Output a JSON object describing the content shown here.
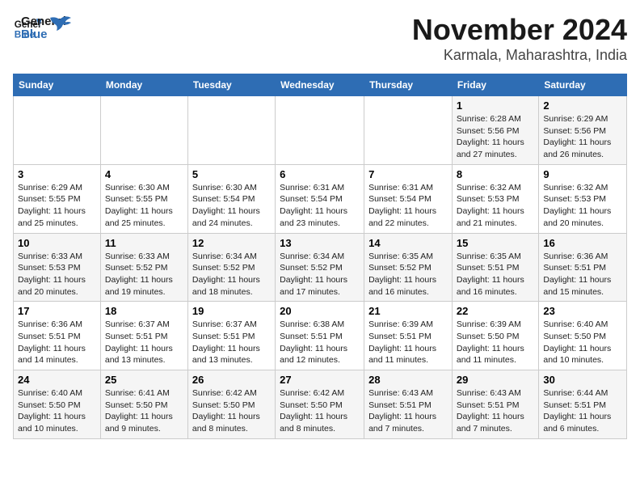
{
  "logo": {
    "line1": "General",
    "line2": "Blue"
  },
  "title": "November 2024",
  "location": "Karmala, Maharashtra, India",
  "days_header": [
    "Sunday",
    "Monday",
    "Tuesday",
    "Wednesday",
    "Thursday",
    "Friday",
    "Saturday"
  ],
  "weeks": [
    [
      {
        "day": "",
        "info": ""
      },
      {
        "day": "",
        "info": ""
      },
      {
        "day": "",
        "info": ""
      },
      {
        "day": "",
        "info": ""
      },
      {
        "day": "",
        "info": ""
      },
      {
        "day": "1",
        "info": "Sunrise: 6:28 AM\nSunset: 5:56 PM\nDaylight: 11 hours\nand 27 minutes."
      },
      {
        "day": "2",
        "info": "Sunrise: 6:29 AM\nSunset: 5:56 PM\nDaylight: 11 hours\nand 26 minutes."
      }
    ],
    [
      {
        "day": "3",
        "info": "Sunrise: 6:29 AM\nSunset: 5:55 PM\nDaylight: 11 hours\nand 25 minutes."
      },
      {
        "day": "4",
        "info": "Sunrise: 6:30 AM\nSunset: 5:55 PM\nDaylight: 11 hours\nand 25 minutes."
      },
      {
        "day": "5",
        "info": "Sunrise: 6:30 AM\nSunset: 5:54 PM\nDaylight: 11 hours\nand 24 minutes."
      },
      {
        "day": "6",
        "info": "Sunrise: 6:31 AM\nSunset: 5:54 PM\nDaylight: 11 hours\nand 23 minutes."
      },
      {
        "day": "7",
        "info": "Sunrise: 6:31 AM\nSunset: 5:54 PM\nDaylight: 11 hours\nand 22 minutes."
      },
      {
        "day": "8",
        "info": "Sunrise: 6:32 AM\nSunset: 5:53 PM\nDaylight: 11 hours\nand 21 minutes."
      },
      {
        "day": "9",
        "info": "Sunrise: 6:32 AM\nSunset: 5:53 PM\nDaylight: 11 hours\nand 20 minutes."
      }
    ],
    [
      {
        "day": "10",
        "info": "Sunrise: 6:33 AM\nSunset: 5:53 PM\nDaylight: 11 hours\nand 20 minutes."
      },
      {
        "day": "11",
        "info": "Sunrise: 6:33 AM\nSunset: 5:52 PM\nDaylight: 11 hours\nand 19 minutes."
      },
      {
        "day": "12",
        "info": "Sunrise: 6:34 AM\nSunset: 5:52 PM\nDaylight: 11 hours\nand 18 minutes."
      },
      {
        "day": "13",
        "info": "Sunrise: 6:34 AM\nSunset: 5:52 PM\nDaylight: 11 hours\nand 17 minutes."
      },
      {
        "day": "14",
        "info": "Sunrise: 6:35 AM\nSunset: 5:52 PM\nDaylight: 11 hours\nand 16 minutes."
      },
      {
        "day": "15",
        "info": "Sunrise: 6:35 AM\nSunset: 5:51 PM\nDaylight: 11 hours\nand 16 minutes."
      },
      {
        "day": "16",
        "info": "Sunrise: 6:36 AM\nSunset: 5:51 PM\nDaylight: 11 hours\nand 15 minutes."
      }
    ],
    [
      {
        "day": "17",
        "info": "Sunrise: 6:36 AM\nSunset: 5:51 PM\nDaylight: 11 hours\nand 14 minutes."
      },
      {
        "day": "18",
        "info": "Sunrise: 6:37 AM\nSunset: 5:51 PM\nDaylight: 11 hours\nand 13 minutes."
      },
      {
        "day": "19",
        "info": "Sunrise: 6:37 AM\nSunset: 5:51 PM\nDaylight: 11 hours\nand 13 minutes."
      },
      {
        "day": "20",
        "info": "Sunrise: 6:38 AM\nSunset: 5:51 PM\nDaylight: 11 hours\nand 12 minutes."
      },
      {
        "day": "21",
        "info": "Sunrise: 6:39 AM\nSunset: 5:51 PM\nDaylight: 11 hours\nand 11 minutes."
      },
      {
        "day": "22",
        "info": "Sunrise: 6:39 AM\nSunset: 5:50 PM\nDaylight: 11 hours\nand 11 minutes."
      },
      {
        "day": "23",
        "info": "Sunrise: 6:40 AM\nSunset: 5:50 PM\nDaylight: 11 hours\nand 10 minutes."
      }
    ],
    [
      {
        "day": "24",
        "info": "Sunrise: 6:40 AM\nSunset: 5:50 PM\nDaylight: 11 hours\nand 10 minutes."
      },
      {
        "day": "25",
        "info": "Sunrise: 6:41 AM\nSunset: 5:50 PM\nDaylight: 11 hours\nand 9 minutes."
      },
      {
        "day": "26",
        "info": "Sunrise: 6:42 AM\nSunset: 5:50 PM\nDaylight: 11 hours\nand 8 minutes."
      },
      {
        "day": "27",
        "info": "Sunrise: 6:42 AM\nSunset: 5:50 PM\nDaylight: 11 hours\nand 8 minutes."
      },
      {
        "day": "28",
        "info": "Sunrise: 6:43 AM\nSunset: 5:51 PM\nDaylight: 11 hours\nand 7 minutes."
      },
      {
        "day": "29",
        "info": "Sunrise: 6:43 AM\nSunset: 5:51 PM\nDaylight: 11 hours\nand 7 minutes."
      },
      {
        "day": "30",
        "info": "Sunrise: 6:44 AM\nSunset: 5:51 PM\nDaylight: 11 hours\nand 6 minutes."
      }
    ]
  ]
}
